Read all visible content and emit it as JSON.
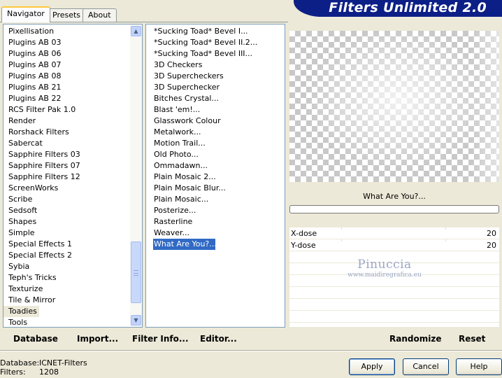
{
  "window": {
    "title": "Filters Unlimited 2.0"
  },
  "tabs": [
    {
      "label": "Navigator",
      "active": true
    },
    {
      "label": "Presets",
      "active": false
    },
    {
      "label": "About",
      "active": false
    }
  ],
  "categories": [
    "Pixellisation",
    "Plugins AB 03",
    "Plugins AB 06",
    "Plugins AB 07",
    "Plugins AB 08",
    "Plugins AB 21",
    "Plugins AB 22",
    "RCS Filter Pak 1.0",
    "Render",
    "Rorshack Filters",
    "Sabercat",
    "Sapphire Filters 03",
    "Sapphire Filters 07",
    "Sapphire Filters 12",
    "ScreenWorks",
    "Scribe",
    "Sedsoft",
    "Shapes",
    "Simple",
    "Special Effects 1",
    "Special Effects 2",
    "Sybia",
    "Teph's Tricks",
    "Texturize",
    "Tile & Mirror",
    "Toadies",
    "Tools"
  ],
  "selected_category": "Toadies",
  "filters": [
    "*Sucking Toad*  Bevel I...",
    "*Sucking Toad*  Bevel II.2...",
    "*Sucking Toad*  Bevel III...",
    "3D Checkers",
    "3D Supercheckers",
    "3D Superchecker",
    "Bitches Crystal...",
    "Blast 'em!...",
    "Glasswork Colour",
    "Metalwork...",
    "Motion Trail...",
    "Old Photo...",
    "Ommadawn...",
    "Plain Mosaic 2...",
    "Plain Mosaic Blur...",
    "Plain Mosaic...",
    "Posterize...",
    "Rasterline",
    "Weaver...",
    "What Are You?..."
  ],
  "selected_filter": "What Are You?...",
  "preview": {
    "filter_name": "What Are You?..."
  },
  "params": [
    {
      "label": "X-dose",
      "value": "20"
    },
    {
      "label": "Y-dose",
      "value": "20"
    }
  ],
  "watermark": {
    "title": "Pinuccia",
    "url": "www.maidiregrafica.eu"
  },
  "toolbar": {
    "database": "Database",
    "import": "Import...",
    "filter_info": "Filter Info...",
    "editor": "Editor...",
    "randomize": "Randomize",
    "reset": "Reset"
  },
  "info": {
    "database_label": "Database:",
    "database_value": "ICNET-Filters",
    "filters_label": "Filters:",
    "filters_value": "1208"
  },
  "buttons": {
    "apply": "Apply",
    "cancel": "Cancel",
    "help": "Help"
  },
  "colors": {
    "banner": "#0c1f87",
    "selection": "#316ac5",
    "dialog_bg": "#ece9d8"
  }
}
